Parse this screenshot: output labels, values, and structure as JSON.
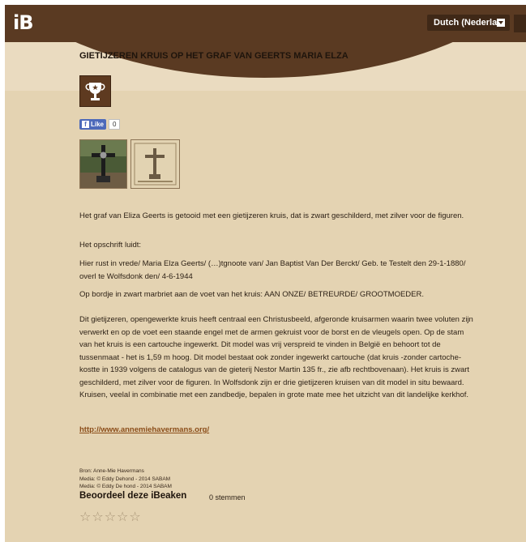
{
  "header": {
    "logo": "iB",
    "language": "Dutch (Nederla"
  },
  "article": {
    "title": "GIETIJZEREN KRUIS OP HET GRAF VAN GEERTS MARIA ELZA",
    "like_label": "Like",
    "like_count": "0",
    "paragraphs": [
      "Het graf van Eliza Geerts is getooid met een gietijzeren kruis, dat is zwart geschilderd, met zilver voor de figuren.",
      "Het opschrift luidt:",
      "Hier rust in vrede/ Maria Elza Geerts/ (…)tgnoote van/ Jan Baptist Van Der Berckt/ Geb. te Testelt den 29-1-1880/ overl te Wolfsdonk den/ 4-6-1944",
      "Op bordje in zwart marbriet aan de voet van het kruis: AAN ONZE/ BETREURDE/ GROOTMOEDER.",
      "Dit gietijzeren, opengewerkte kruis heeft centraal een Christusbeeld, afgeronde kruisarmen waarin twee voluten zijn verwerkt en op de voet een staande engel met de armen gekruist voor de borst en de vleugels open. Op de stam van het kruis is een cartouche ingewerkt. Dit model was vrij verspreid te vinden in België en behoort tot de tussenmaat - het is 1,59 m hoog. Dit model bestaat ook zonder ingewerkt cartouche (dat kruis -zonder cartoche- kostte in 1939 volgens de catalogus van de gieterij Nestor Martin 135 fr., zie afb rechtbovenaan). Het kruis is zwart geschilderd, met zilver voor de figuren. In Wolfsdonk zijn er drie gietijzeren kruisen van dit model in situ bewaard. Kruisen, veelal in combinatie met een zandbedje, bepalen in grote mate mee het uitzicht van dit landelijke kerkhof."
    ],
    "link": "http://www.annemiehavermans.org/",
    "credits": [
      "Bron: Anne-Mie Havermans",
      "Media: © Eddy Dehond - 2014 SABAM",
      "Media: © Eddy De hond - 2014 SABAM"
    ],
    "rating_label": "Beoordeel deze iBeaken",
    "votes": "0 stemmen",
    "stars": [
      "☆",
      "☆",
      "☆",
      "☆",
      "☆"
    ]
  },
  "colors": {
    "header_brown": "#5a3a22",
    "background": "#e4d3b2",
    "facebook": "#4c69ba",
    "link": "#8b4d19"
  },
  "icons": {
    "trophy": "trophy-icon",
    "dropdown": "chevron-down-icon"
  }
}
